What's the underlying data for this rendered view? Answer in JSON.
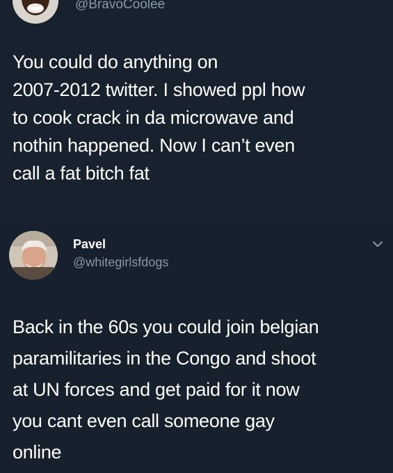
{
  "tweets": [
    {
      "handle": "@BravoCoolee",
      "text_lines": [
        "You could do anything on",
        "2007-2012 twitter. I showed ppl how",
        "to cook crack in da microwave and",
        "nothin happened. Now I can’t even",
        "call a fat bitch fat"
      ]
    },
    {
      "name": "Pavel",
      "handle": "@whitegirlsfdogs",
      "menu_icon": "chevron-down-icon",
      "text_lines": [
        "Back in the 60s you could join belgian",
        "paramilitaries in the Congo and shoot",
        "at UN forces and get paid for it now",
        "you cant even call someone gay",
        "online"
      ]
    }
  ],
  "colors": {
    "background": "#15202b",
    "text": "#ffffff",
    "secondary_text": "#8899a6"
  }
}
